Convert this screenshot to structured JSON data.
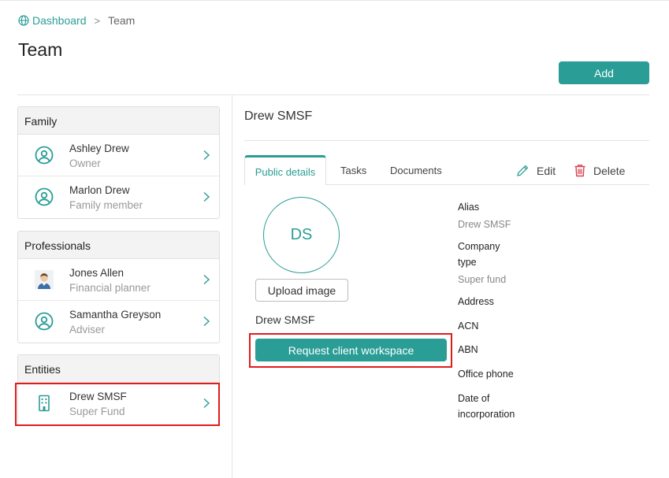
{
  "breadcrumb": {
    "home": "Dashboard",
    "separator": ">",
    "current": "Team"
  },
  "page": {
    "title": "Team",
    "add_label": "Add"
  },
  "groups": [
    {
      "title": "Family",
      "items": [
        {
          "name": "Ashley Drew",
          "role": "Owner",
          "icon": "person-circle-icon"
        },
        {
          "name": "Marlon Drew",
          "role": "Family member",
          "icon": "person-circle-icon"
        }
      ]
    },
    {
      "title": "Professionals",
      "items": [
        {
          "name": "Jones Allen",
          "role": "Financial planner",
          "icon": "avatar-photo"
        },
        {
          "name": "Samantha Greyson",
          "role": "Adviser",
          "icon": "person-circle-icon"
        }
      ]
    },
    {
      "title": "Entities",
      "items": [
        {
          "name": "Drew SMSF",
          "role": "Super Fund",
          "icon": "building-icon"
        }
      ]
    }
  ],
  "entity": {
    "title": "Drew SMSF",
    "tabs": [
      "Public details",
      "Tasks",
      "Documents"
    ],
    "edit_label": "Edit",
    "delete_label": "Delete",
    "initials": "DS",
    "upload_label": "Upload image",
    "display_name": "Drew SMSF",
    "request_label": "Request client workspace"
  },
  "details": {
    "alias_label": "Alias",
    "alias_value": "Drew SMSF",
    "company_type_label_1": "Company",
    "company_type_label_2": "type",
    "company_type_value": "Super fund",
    "address_label": "Address",
    "acn_label": "ACN",
    "abn_label": "ABN",
    "office_phone_label": "Office phone",
    "incorporation_label_1": "Date of",
    "incorporation_label_2": "incorporation"
  },
  "colors": {
    "accent": "#2a9d96",
    "highlight": "#e01b1b",
    "delete": "#d9434f"
  }
}
